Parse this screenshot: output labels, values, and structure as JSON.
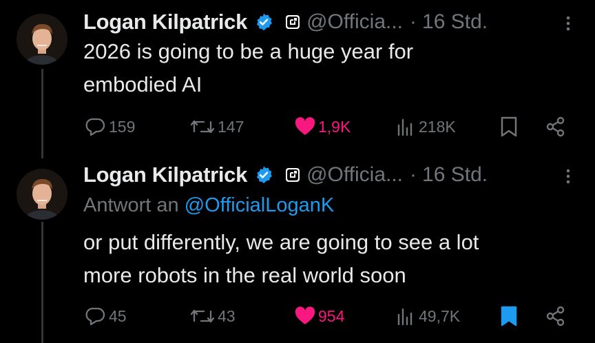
{
  "tweets": [
    {
      "author_name": "Logan Kilpatrick",
      "handle": "@Officia...",
      "separator": "·",
      "time": "16 Std.",
      "reply_prefix": "",
      "reply_handle": "",
      "text_lines": [
        "2026 is going to be a huge year for",
        "embodied AI"
      ],
      "replies": "159",
      "reposts": "147",
      "likes": "1,9K",
      "views": "218K",
      "bookmarked": false
    },
    {
      "author_name": "Logan Kilpatrick",
      "handle": "@Officia...",
      "separator": "·",
      "time": "16 Std.",
      "reply_prefix": "Antwort an ",
      "reply_handle": "@OfficialLoganK",
      "text_lines": [
        "or put differently, we are going to see a lot",
        "more robots in the real world soon"
      ],
      "replies": "45",
      "reposts": "43",
      "likes": "954",
      "views": "49,7K",
      "bookmarked": true
    }
  ],
  "colors": {
    "background": "#000000",
    "text": "#e7e9ea",
    "secondary": "#71767b",
    "like": "#f91880",
    "verified": "#1d9bf0",
    "mention": "#1d9bf0",
    "bookmark_active": "#1d9bf0"
  },
  "icons": [
    "verified-badge-icon",
    "affiliate-badge-icon",
    "more-icon",
    "reply-icon",
    "repost-icon",
    "like-icon",
    "views-icon",
    "bookmark-icon",
    "share-icon"
  ]
}
